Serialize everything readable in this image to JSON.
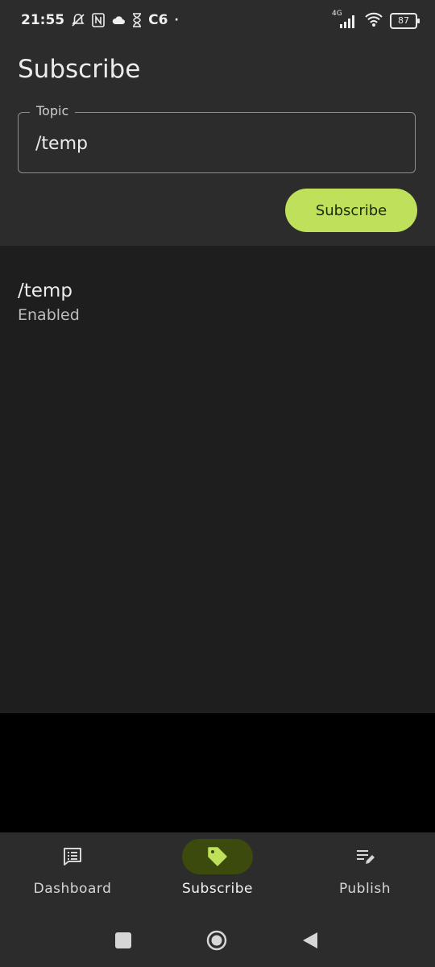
{
  "status_bar": {
    "time": "21:55",
    "carrier_label": "C6",
    "network_type": "4G",
    "battery_level": "87"
  },
  "header": {
    "title": "Subscribe",
    "topic_field": {
      "label": "Topic",
      "value": "/temp"
    },
    "subscribe_button_label": "Subscribe"
  },
  "subscriptions": [
    {
      "topic": "/temp",
      "status": "Enabled"
    }
  ],
  "bottom_nav": {
    "items": [
      {
        "label": "Dashboard",
        "icon": "dashboard-icon",
        "active": false
      },
      {
        "label": "Subscribe",
        "icon": "tag-icon",
        "active": true
      },
      {
        "label": "Publish",
        "icon": "edit-list-icon",
        "active": false
      }
    ]
  },
  "colors": {
    "accent": "#bfe05a",
    "accent_dark": "#3d4a0e",
    "surface": "#2c2c2c",
    "background": "#1e1e1e"
  }
}
